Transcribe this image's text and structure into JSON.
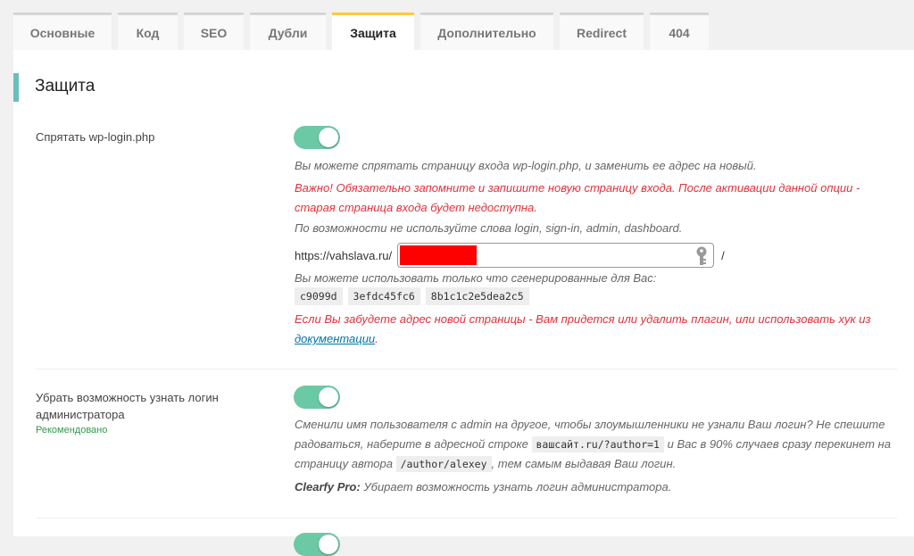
{
  "tabs": [
    {
      "label": "Основные",
      "active": false
    },
    {
      "label": "Код",
      "active": false
    },
    {
      "label": "SEO",
      "active": false
    },
    {
      "label": "Дубли",
      "active": false
    },
    {
      "label": "Защита",
      "active": true
    },
    {
      "label": "Дополнительно",
      "active": false
    },
    {
      "label": "Redirect",
      "active": false
    },
    {
      "label": "404",
      "active": false
    }
  ],
  "section": {
    "title": "Защита"
  },
  "option_hide_login": {
    "label": "Спрятать wp-login.php",
    "enabled": true,
    "desc1": "Вы можете спрятать страницу входа wp-login.php, и заменить ее адрес на новый.",
    "warning": "Важно! Обязательно запомните и запишите новую страницу входа. После активации данной опции - старая страница входа будет недоступна.",
    "desc2": "По возможности не используйте слова login, sign-in, admin, dashboard.",
    "url_prefix": "https://vahslava.ru/",
    "url_value": "",
    "url_suffix": "/",
    "generated_label": "Вы можете использовать только что сгенерированные для Вас:",
    "generated": [
      "c9099d",
      "3efdc45fc6",
      "8b1c1c2e5dea2c5"
    ],
    "forget_warning": "Если Вы забудете адрес новой страницы - Вам придется или удалить плагин, или использовать хук из",
    "doc_link": "документации",
    "doc_link_tail": "."
  },
  "option_hide_admin_login": {
    "label": "Убрать возможность узнать логин администратора",
    "badge": "Рекомендовано",
    "enabled": true,
    "desc_part1": "Сменили имя пользователя с admin на другое, чтобы злоумышленники не узнали Ваш логин? Не спешите радоваться, наберите в адресной строке",
    "code1": "вашсайт.ru/?author=1",
    "desc_part2": "и Вас в 90% случаев сразу перекинет на страницу автора",
    "code2": "/author/alexey",
    "desc_part3": ", тем самым выдавая Ваш логин.",
    "pro_label": "Clearfy Pro:",
    "pro_text": "Убирает возможность узнать логин администратора."
  }
}
